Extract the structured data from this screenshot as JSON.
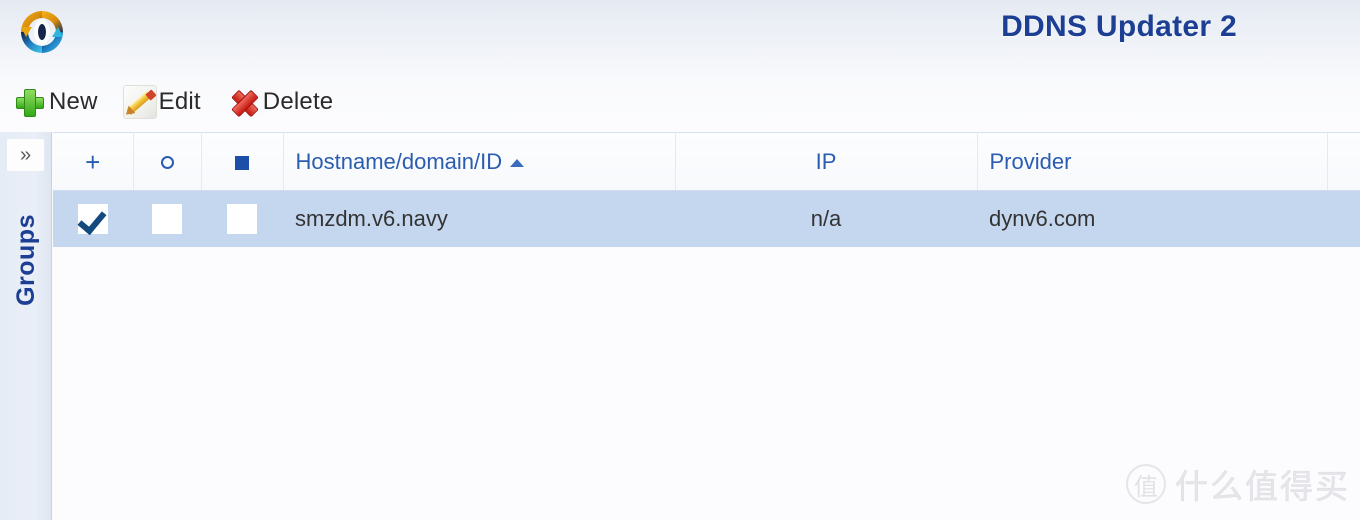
{
  "header": {
    "title": "DDNS Updater 2",
    "logo_icon": "sync-refresh-circle-icon"
  },
  "toolbar": {
    "buttons": [
      {
        "label": "New",
        "icon": "green-plus-icon"
      },
      {
        "label": "Edit",
        "icon": "pencil-edit-icon"
      },
      {
        "label": "Delete",
        "icon": "red-x-delete-icon"
      }
    ]
  },
  "sidebar": {
    "expand_icon": "»",
    "groups_label": "Groups"
  },
  "table": {
    "columns": [
      {
        "key": "chk",
        "label": "+",
        "icon": "plus-icon",
        "align": "center"
      },
      {
        "key": "circ",
        "label": "",
        "icon": "circle-icon",
        "align": "center"
      },
      {
        "key": "sq",
        "label": "",
        "icon": "square-icon",
        "align": "center"
      },
      {
        "key": "host",
        "label": "Hostname/domain/ID",
        "icon": "sort-ascending-icon",
        "align": "left"
      },
      {
        "key": "ip",
        "label": "IP",
        "icon": "",
        "align": "center"
      },
      {
        "key": "prov",
        "label": "Provider",
        "icon": "",
        "align": "left"
      },
      {
        "key": "extra",
        "label": "",
        "icon": "",
        "align": "left"
      }
    ],
    "sort": {
      "column": "Hostname/domain/ID",
      "direction": "ascending"
    },
    "rows": [
      {
        "selected": true,
        "checkbox_checked": true,
        "circle_checked": false,
        "square_checked": false,
        "hostname": "smzdm.v6.navy",
        "ip": "n/a",
        "provider": "dynv6.com",
        "extra": ""
      }
    ]
  },
  "watermark": {
    "badge": "值",
    "text": "什么值得买"
  },
  "colors": {
    "title_blue": "#1c3f94",
    "header_text_blue": "#2a5db0",
    "row_selected": "#c5d7ef",
    "check_blue": "#14497f",
    "plus_green": "#35a818",
    "delete_red": "#c41a12"
  }
}
